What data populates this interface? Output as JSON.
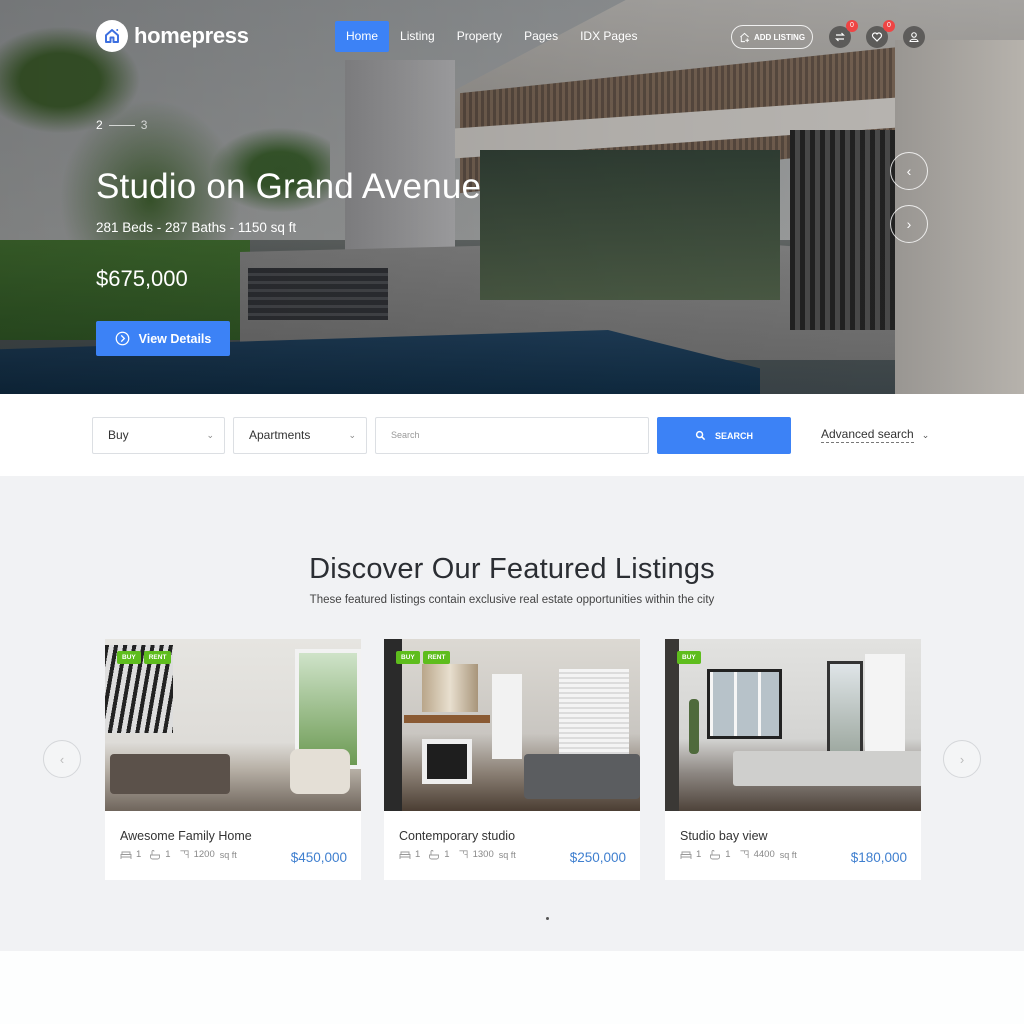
{
  "header": {
    "logo_text": "homepress",
    "nav": [
      {
        "label": "Home",
        "active": true
      },
      {
        "label": "Listing",
        "active": false
      },
      {
        "label": "Property",
        "active": false
      },
      {
        "label": "Pages",
        "active": false
      },
      {
        "label": "IDX Pages",
        "active": false
      }
    ],
    "add_listing_label": "ADD LISTING",
    "compare_count": "0",
    "favorites_count": "0"
  },
  "hero": {
    "slide_current": "2",
    "slide_total": "3",
    "title": "Studio on Grand Avenue",
    "meta": "281 Beds - 287 Baths - 1150 sq ft",
    "price": "$675,000",
    "view_details_label": "View Details",
    "prev_icon": "‹",
    "next_icon": "›"
  },
  "search": {
    "type_select": "Buy",
    "category_select": "Apartments",
    "search_placeholder": "Search",
    "search_button_label": "SEARCH",
    "advanced_label": "Advanced search"
  },
  "featured": {
    "title": "Discover Our Featured Listings",
    "subtitle": "These featured listings contain exclusive real estate opportunities within the city",
    "listings": [
      {
        "title": "Awesome Family Home",
        "beds": "1",
        "baths": "1",
        "area": "1200",
        "area_unit": "sq ft",
        "price": "$450,000",
        "tags": [
          "BUY",
          "RENT"
        ]
      },
      {
        "title": "Contemporary studio",
        "beds": "1",
        "baths": "1",
        "area": "1300",
        "area_unit": "sq ft",
        "price": "$250,000",
        "tags": [
          "BUY",
          "RENT"
        ]
      },
      {
        "title": "Studio bay view",
        "beds": "1",
        "baths": "1",
        "area": "4400",
        "area_unit": "sq ft",
        "price": "$180,000",
        "tags": [
          "BUY"
        ]
      }
    ],
    "prev_icon": "‹",
    "next_icon": "›"
  },
  "colors": {
    "accent": "#3c82f6",
    "tag_green": "#5ebd1d",
    "price_blue": "#3f7fcf",
    "badge_red": "#ef4444",
    "section_bg": "#f1f2f4"
  }
}
